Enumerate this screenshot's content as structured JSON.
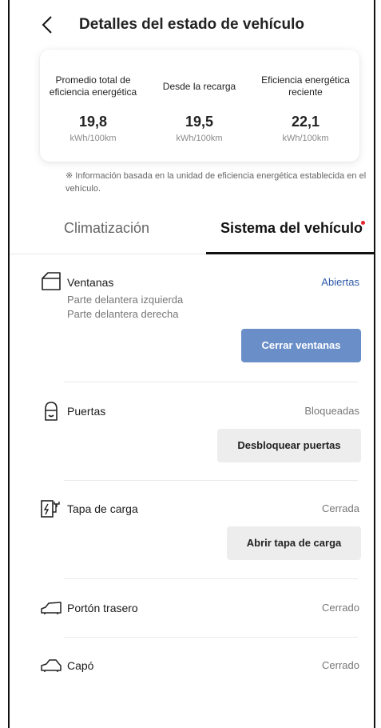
{
  "header": {
    "title": "Detalles del estado de vehículo",
    "back_icon": "chevron-left-icon"
  },
  "efficiency": {
    "columns": [
      {
        "label": "Promedio total de eficiencia energética",
        "value": "19,8",
        "unit": "kWh/100km"
      },
      {
        "label": "Desde la recarga",
        "value": "19,5",
        "unit": "kWh/100km"
      },
      {
        "label": "Eficiencia energética reciente",
        "value": "22,1",
        "unit": "kWh/100km"
      }
    ],
    "note": "※ Información basada en la unidad de eficiencia energética establecida en el vehículo."
  },
  "tabs": [
    {
      "label": "Climatización",
      "active": false
    },
    {
      "label": "Sistema del vehículo",
      "active": true,
      "notification_dot": true
    }
  ],
  "items": {
    "windows": {
      "title": "Ventanas",
      "status": "Abiertas",
      "details": [
        "Parte delantera izquierda",
        "Parte delantera derecha"
      ],
      "action": "Cerrar ventanas",
      "icon": "window-icon"
    },
    "doors": {
      "title": "Puertas",
      "status": "Bloqueadas",
      "action": "Desbloquear puertas",
      "icon": "door-icon"
    },
    "charge_cap": {
      "title": "Tapa de carga",
      "status": "Cerrada",
      "action": "Abrir tapa de carga",
      "icon": "charge-port-icon"
    },
    "tailgate": {
      "title": "Portón trasero",
      "status": "Cerrado",
      "icon": "tailgate-icon"
    },
    "hood": {
      "title": "Capó",
      "status": "Cerrado",
      "icon": "hood-icon"
    }
  },
  "colors": {
    "accent_blue": "#2f5aa8",
    "button_blue": "#6a8fc8",
    "notification_red": "#e5262e"
  }
}
